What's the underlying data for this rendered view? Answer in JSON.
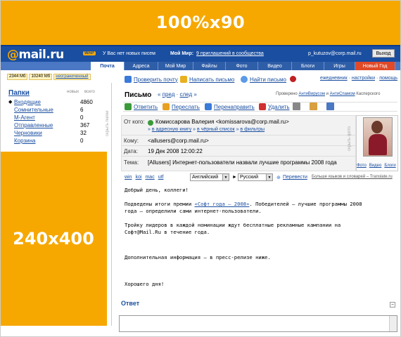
{
  "banners": {
    "top": "100%x90",
    "left": "240x400"
  },
  "header": {
    "logo": "@mail.ru",
    "wap": "WAP",
    "no_new": "У Вас нет новых писем",
    "moy_mir": "Мой Мир:",
    "invites": "9 приглашений в сообщества",
    "user_email": "p_kutuzov@corp.mail.ru",
    "exit": "Выход"
  },
  "tabs": [
    "Почта",
    "Адреса",
    "Мой Мир",
    "Файлы",
    "Фото",
    "Видео",
    "Блоги",
    "Игры",
    "Новый Год"
  ],
  "quota": {
    "used": "2344 Мб",
    "total": "10240 Мб",
    "unlimited": "неограниченный"
  },
  "folders": {
    "title": "Папки",
    "col_new": "новых",
    "col_all": "всего",
    "side_label": "скрыть папки",
    "items": [
      {
        "name": "Входящие",
        "count": "4860"
      },
      {
        "name": "Сомнительные",
        "count": "6"
      },
      {
        "name": "М-Агент",
        "count": "0"
      },
      {
        "name": "Отправленные",
        "count": "367"
      },
      {
        "name": "Черновики",
        "count": "32"
      },
      {
        "name": "Корзина",
        "count": "0"
      }
    ]
  },
  "toolbar": {
    "check": "Проверить почту",
    "write": "Написать письмо",
    "find": "Найти письмо",
    "diary": "ежедневник",
    "settings": "настройки",
    "help": "помощь"
  },
  "message": {
    "title": "Письмо",
    "prev": "пред",
    "next": "след",
    "av_checked": "Проверено",
    "av_antivirus": "АнтиВирусом",
    "av_and": "и",
    "av_antispam": "АнтиСпамом",
    "av_kaspersky": "Касперского",
    "actions": {
      "reply": "Ответить",
      "forward": "Переслать",
      "redirect": "Перенаправить",
      "delete": "Удалить"
    },
    "from_label": "От кого:",
    "from_value": "Комиссарова Валерия <komissarova@corp.mail.ru>",
    "from_addbook": "в адресную книгу",
    "from_blacklist": "в чёрный список",
    "from_filters": "в фильтры",
    "to_label": "Кому:",
    "to_value": "<allusers@corp.mail.ru>",
    "date_label": "Дата:",
    "date_value": "19 Дек 2008 12:00:22",
    "subject_label": "Тема:",
    "subject_value": "[Allusers] Интернет-пользователи назвали лучшие программы 2008 года",
    "photo_side": "скрыть фото",
    "photo_links": [
      "Фото",
      "Видео",
      "Блоги"
    ],
    "encodings": [
      "win",
      "koi",
      "mac",
      "utf"
    ],
    "lang_from": "Английский",
    "lang_to": "Русский",
    "translate": "Перевести",
    "more_langs": "Больше языков и словарей – Translate.ru",
    "body": {
      "greeting": "Добрый день, коллеги!",
      "p1_a": "Подведены итоги премии ",
      "p1_link": "«Софт года – 2008»",
      "p1_b": ". Победителей – лучшие программы 2008",
      "p1_c": "года – определили сами интернет-пользователи.",
      "p2_a": "Тройку лидеров в каждой номинации ждут бесплатные рекламные кампании на",
      "p2_b": "Софт@Mail.Ru в течение года.",
      "p3": "Дополнительная информация – в пресс-релизе ниже.",
      "closing": "Хорошего дня!"
    }
  },
  "reply": {
    "title": "Ответ"
  },
  "colors": {
    "brand_blue": "#1a4ea0",
    "banner_orange": "#f6a800",
    "new_year_tab": "#e04a28"
  }
}
